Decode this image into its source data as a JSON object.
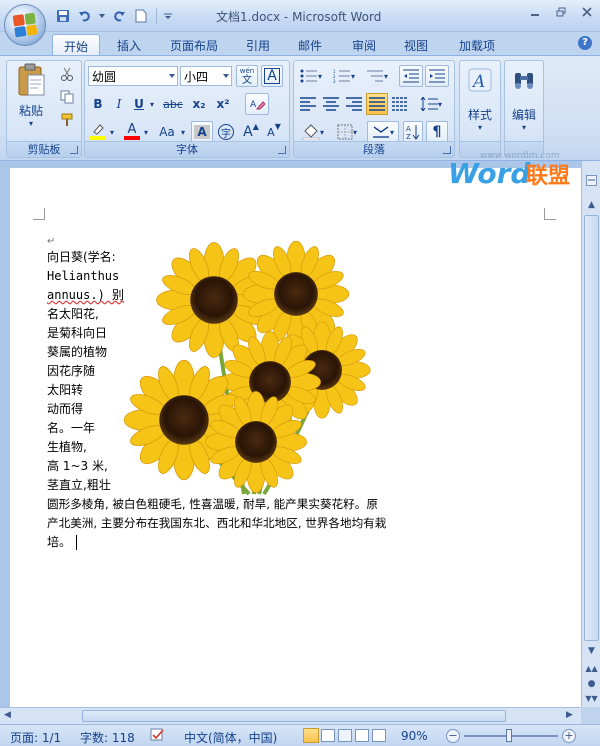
{
  "window": {
    "title": "文档1.docx - Microsoft Word"
  },
  "tabs": [
    "开始",
    "插入",
    "页面布局",
    "引用",
    "邮件",
    "审阅",
    "视图",
    "加载项"
  ],
  "ribbon": {
    "clipboard": {
      "label": "剪贴板",
      "paste_label": "粘贴"
    },
    "font": {
      "label": "字体",
      "font_name": "幼圆",
      "font_size": "小四",
      "phonetic": "wén",
      "phonetic_char": "文",
      "border_char": "A",
      "bold": "B",
      "italic": "I",
      "underline": "U",
      "strike": "abc",
      "subscript": "x₂",
      "superscript": "x²",
      "font_color": "A",
      "case": "Aa",
      "shade": "A",
      "enclose": "字",
      "grow": "A",
      "shrink": "A"
    },
    "paragraph": {
      "label": "段落"
    },
    "styles": {
      "label": "样式"
    },
    "editing": {
      "label": "编辑"
    }
  },
  "watermark": {
    "brand": "Word",
    "brand_cn": "联盟",
    "url": "www.wordlm.com"
  },
  "document": {
    "para_mark": "↵",
    "lines": [
      "向日葵(学名:",
      "Helianthus",
      "annuus.) 别",
      "名太阳花,",
      "是菊科向日",
      "葵属的植物",
      "因花序随",
      "太阳转",
      "动而得",
      "名。一年",
      "生植物,",
      "高 1~3 米,",
      "茎直立,粗壮",
      "圆形多棱角, 被白色粗硬毛, 性喜温暖, 耐旱, 能产果实葵花籽。原",
      "产北美洲, 主要分布在我国东北、西北和华北地区, 世界各地均有栽",
      "培。"
    ]
  },
  "status": {
    "page": "页面: 1/1",
    "words": "字数: 118",
    "language": "中文(简体，中国)",
    "zoom": "90%"
  },
  "colors": {
    "accent": "#15428b",
    "ribbon_bg": "#d1e0f4",
    "highlight": "#ffff00",
    "font_color": "#ff0000"
  }
}
